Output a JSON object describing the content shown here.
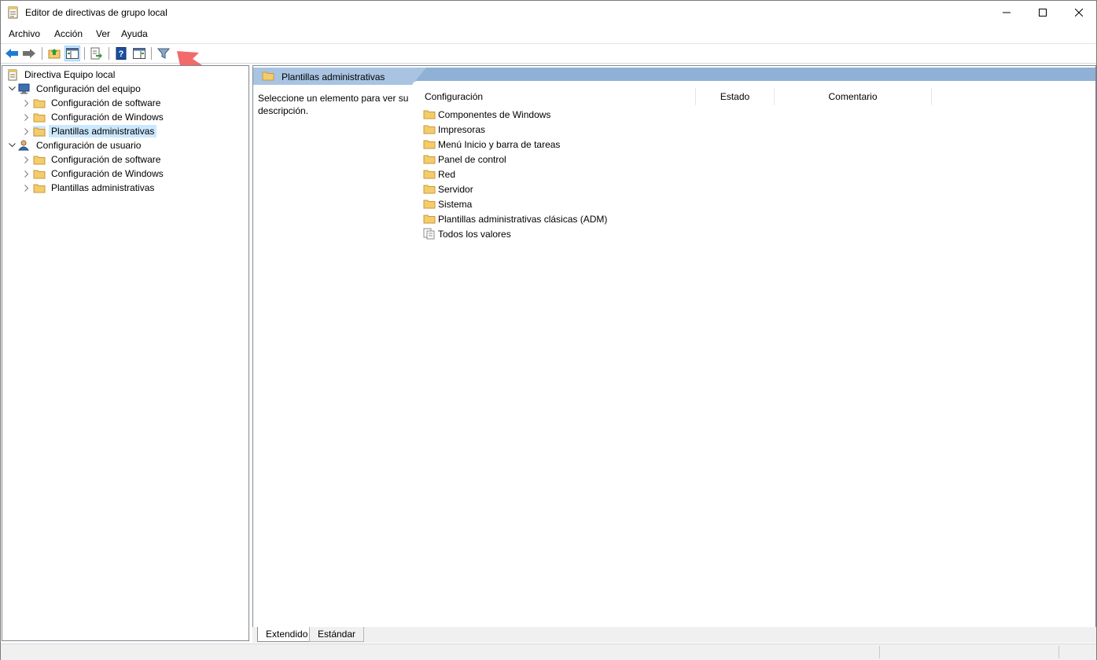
{
  "window": {
    "title": "Editor de directivas de grupo local",
    "controls": {
      "minimize": "—",
      "maximize": "☐",
      "close": "✕"
    }
  },
  "menu": [
    "Archivo",
    "Acción",
    "Ver",
    "Ayuda"
  ],
  "toolbar": {
    "buttons": [
      "back-icon",
      "forward-icon",
      "up-folder-icon",
      "show-hide-tree-icon",
      "export-list-icon",
      "help-icon",
      "action-pane-icon",
      "filter-icon"
    ]
  },
  "tree": {
    "root": "Directiva Equipo local",
    "computer": {
      "label": "Configuración del equipo",
      "children": [
        "Configuración de software",
        "Configuración de Windows",
        "Plantillas administrativas"
      ]
    },
    "user": {
      "label": "Configuración de usuario",
      "children": [
        "Configuración de software",
        "Configuración de Windows",
        "Plantillas administrativas"
      ]
    }
  },
  "content": {
    "header_title": "Plantillas administrativas",
    "description": "Seleccione un elemento para ver su descripción.",
    "columns": [
      "Configuración",
      "Estado",
      "Comentario"
    ],
    "items": [
      "Componentes de Windows",
      "Impresoras",
      "Menú Inicio y barra de tareas",
      "Panel de control",
      "Red",
      "Servidor",
      "Sistema",
      "Plantillas administrativas clásicas (ADM)",
      "Todos los valores"
    ]
  },
  "tabs": [
    "Extendido",
    "Estándar"
  ],
  "colors": {
    "selection": "#cce8ff",
    "header_band": "#8fb1d6",
    "annotation_arrow": "#f26b6b",
    "folder": "#f4cc6c"
  }
}
